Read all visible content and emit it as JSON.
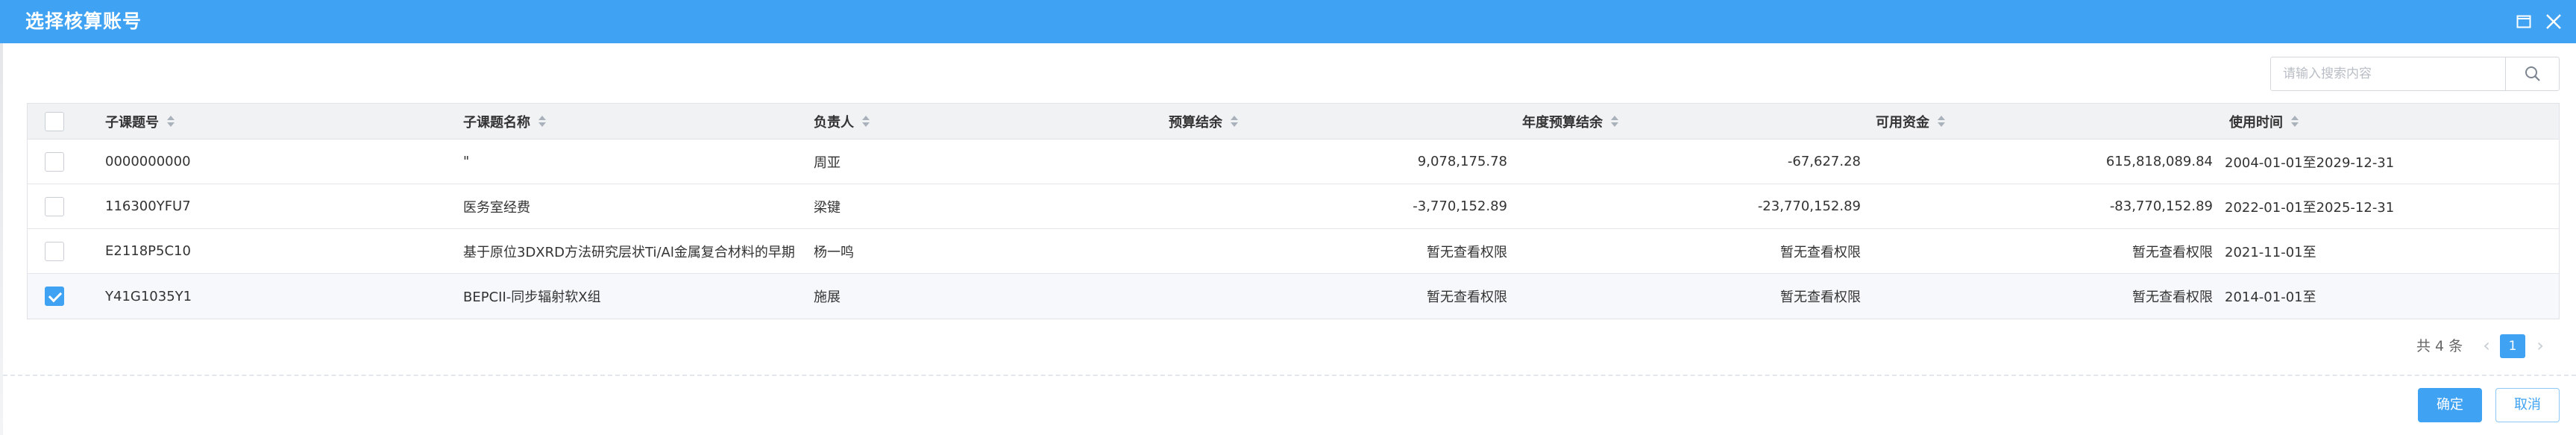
{
  "dialog": {
    "title": "选择核算账号",
    "colors": {
      "titlebar": "#3fa2f2",
      "accent": "#3fa2f2"
    }
  },
  "search": {
    "placeholder": "请输入搜索内容",
    "value": "",
    "icon": "search-icon"
  },
  "table": {
    "columns": {
      "code": "子课题号",
      "name": "子课题名称",
      "owner": "负责人",
      "budget_balance": "预算结余",
      "annual_budget_balance": "年度预算结余",
      "available_funds": "可用资金",
      "usage_period": "使用时间"
    },
    "rows": [
      {
        "checked": false,
        "code": "0000000000",
        "name": "\"",
        "owner": "周亚",
        "budget_balance": "9,078,175.78",
        "annual_budget_balance": "-67,627.28",
        "available_funds": "615,818,089.84",
        "usage_period": "2004-01-01至2029-12-31"
      },
      {
        "checked": false,
        "code": "116300YFU7",
        "name": "医务室经费",
        "owner": "梁键",
        "budget_balance": "-3,770,152.89",
        "annual_budget_balance": "-23,770,152.89",
        "available_funds": "-83,770,152.89",
        "usage_period": "2022-01-01至2025-12-31"
      },
      {
        "checked": false,
        "code": "E2118P5C10",
        "name": "基于原位3DXRD方法研究层状Ti/Al金属复合材料的早期",
        "owner": "杨一鸣",
        "budget_balance": "暂无查看权限",
        "annual_budget_balance": "暂无查看权限",
        "available_funds": "暂无查看权限",
        "usage_period": "2021-11-01至"
      },
      {
        "checked": true,
        "code": "Y41G1035Y1",
        "name": "BEPCII-同步辐射软X组",
        "owner": "施展",
        "budget_balance": "暂无查看权限",
        "annual_budget_balance": "暂无查看权限",
        "available_funds": "暂无查看权限",
        "usage_period": "2014-01-01至"
      }
    ]
  },
  "pagination": {
    "total_text": "共 4 条",
    "current_page": "1",
    "prev": "‹",
    "next": "›"
  },
  "footer": {
    "confirm_label": "确定",
    "cancel_label": "取消"
  }
}
